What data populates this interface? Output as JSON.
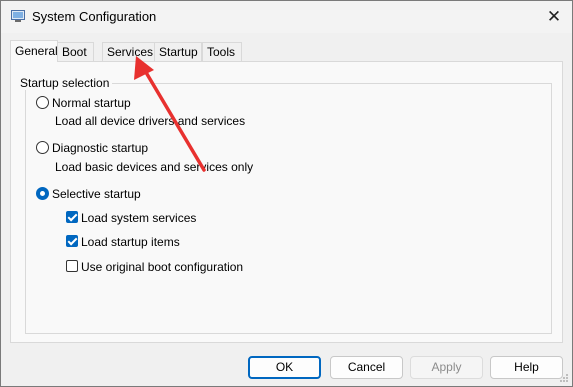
{
  "window": {
    "title": "System Configuration",
    "close_glyph": "✕"
  },
  "tabs": [
    {
      "label": "General",
      "active": true
    },
    {
      "label": "Boot",
      "active": false
    },
    {
      "label": "Services",
      "active": false
    },
    {
      "label": "Startup",
      "active": false
    },
    {
      "label": "Tools",
      "active": false
    }
  ],
  "startup_selection": {
    "legend": "Startup selection",
    "options": [
      {
        "label": "Normal startup",
        "description": "Load all device drivers and services",
        "selected": false
      },
      {
        "label": "Diagnostic startup",
        "description": "Load basic devices and services only",
        "selected": false
      },
      {
        "label": "Selective startup",
        "selected": true
      }
    ],
    "selective_items": [
      {
        "label": "Load system services",
        "checked": true
      },
      {
        "label": "Load startup items",
        "checked": true
      },
      {
        "label": "Use original boot configuration",
        "checked": false
      }
    ]
  },
  "buttons": {
    "ok": "OK",
    "cancel": "Cancel",
    "apply": "Apply",
    "help": "Help"
  },
  "colors": {
    "accent": "#0067c0",
    "annotation_arrow": "#e8312f"
  },
  "icons": {
    "app": "system-configuration-icon",
    "close": "close-icon"
  }
}
